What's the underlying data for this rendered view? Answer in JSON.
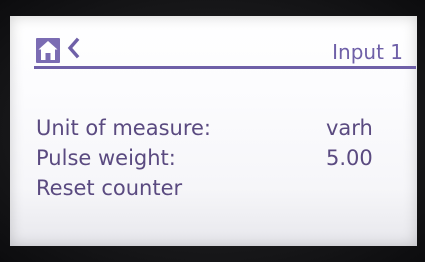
{
  "header": {
    "title": "Input 1",
    "home_icon": "home-icon",
    "back_icon": "chevron-left-icon"
  },
  "menu": {
    "items": [
      {
        "label": "Unit of measure:",
        "value": "varh"
      },
      {
        "label": "Pulse weight:",
        "value": "5.00"
      },
      {
        "label": "Reset counter",
        "value": ""
      }
    ]
  },
  "colors": {
    "accent": "#6f60a8",
    "text": "#5a4a80",
    "screen_background": "#fcfcfe",
    "bezel": "#1b1b1d"
  }
}
